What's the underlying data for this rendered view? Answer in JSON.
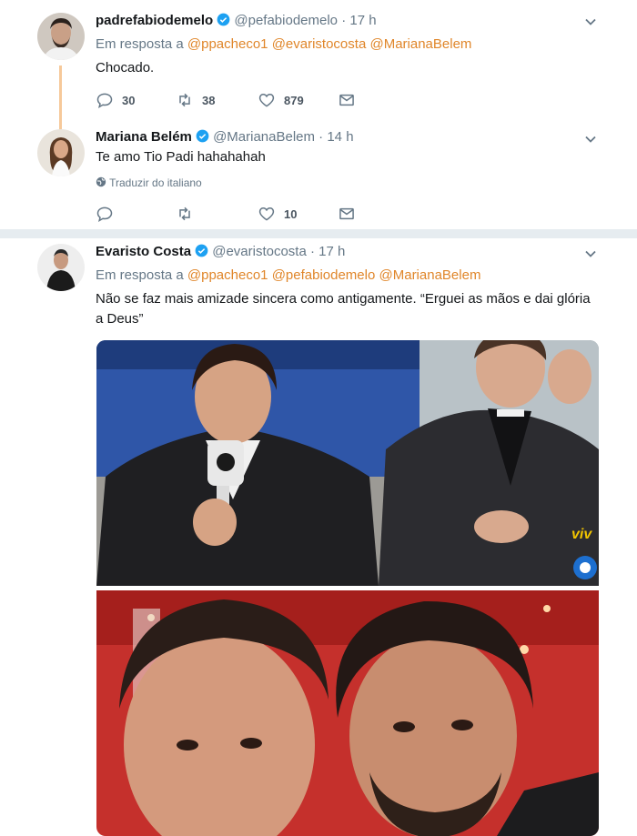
{
  "tweets": [
    {
      "name": "padrefabiodemelo",
      "handle": "@pefabiodemelo",
      "time": "17 h",
      "reply_prefix": "Em resposta a",
      "mentions": [
        "@ppacheco1",
        "@evaristocosta",
        "@MarianaBelem"
      ],
      "text": "Chocado.",
      "replies": "30",
      "retweets": "38",
      "likes": "879"
    },
    {
      "name": "Mariana Belém",
      "handle": "@MarianaBelem",
      "time": "14 h",
      "text": "Te amo Tio Padi hahahahah",
      "translate": "Traduzir do italiano",
      "likes": "10"
    },
    {
      "name": "Evaristo Costa",
      "handle": "@evaristocosta",
      "time": "17 h",
      "reply_prefix": "Em resposta a",
      "mentions": [
        "@ppacheco1",
        "@pefabiodemelo",
        "@MarianaBelem"
      ],
      "text_line1": "Não se faz mais amizade sincera como antigamente. “Erguei as mãos e dai glória",
      "text_line2": "a Deus”",
      "media_badge": "viv"
    }
  ],
  "colors": {
    "accent": "#e0862a",
    "verified": "#1da1f2",
    "muted": "#657786",
    "divider": "#e6ecf0"
  }
}
